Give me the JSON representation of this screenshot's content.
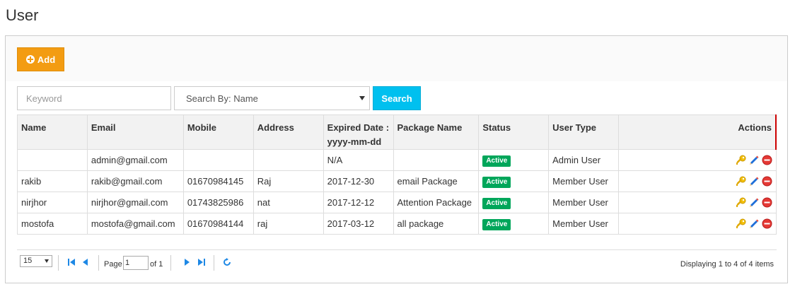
{
  "page": {
    "title": "User"
  },
  "toolbar": {
    "add_label": "Add"
  },
  "search": {
    "keyword_placeholder": "Keyword",
    "searchby_value": "Search By: Name",
    "search_label": "Search"
  },
  "table": {
    "headers": {
      "name": "Name",
      "email": "Email",
      "mobile": "Mobile",
      "address": "Address",
      "expired_line1": "Expired Date :",
      "expired_line2": "yyyy-mm-dd",
      "package": "Package Name",
      "status": "Status",
      "usertype": "User Type",
      "actions": "Actions"
    },
    "rows": [
      {
        "name": "",
        "email": "admin@gmail.com",
        "mobile": "",
        "address": "",
        "expired": "N/A",
        "package": "",
        "status": "Active",
        "usertype": "Admin User"
      },
      {
        "name": "rakib",
        "email": "rakib@gmail.com",
        "mobile": "01670984145",
        "address": "Raj",
        "expired": "2017-12-30",
        "package": "email Package",
        "status": "Active",
        "usertype": "Member User"
      },
      {
        "name": "nirjhor",
        "email": "nirjhor@gmail.com",
        "mobile": "01743825986",
        "address": "nat",
        "expired": "2017-12-12",
        "package": "Attention Package",
        "status": "Active",
        "usertype": "Member User"
      },
      {
        "name": "mostofa",
        "email": "mostofa@gmail.com",
        "mobile": "01670984144",
        "address": "raj",
        "expired": "2017-03-12",
        "package": "all package",
        "status": "Active",
        "usertype": "Member User"
      }
    ]
  },
  "pager": {
    "page_size": "15",
    "page_label": "Page",
    "page_value": "1",
    "of_label": "of 1",
    "displaying": "Displaying 1 to 4 of 4 items"
  },
  "colors": {
    "add": "#f39c12",
    "search": "#00c0ef",
    "active_badge": "#00a65a",
    "pager_icons": "#1e88e5"
  }
}
